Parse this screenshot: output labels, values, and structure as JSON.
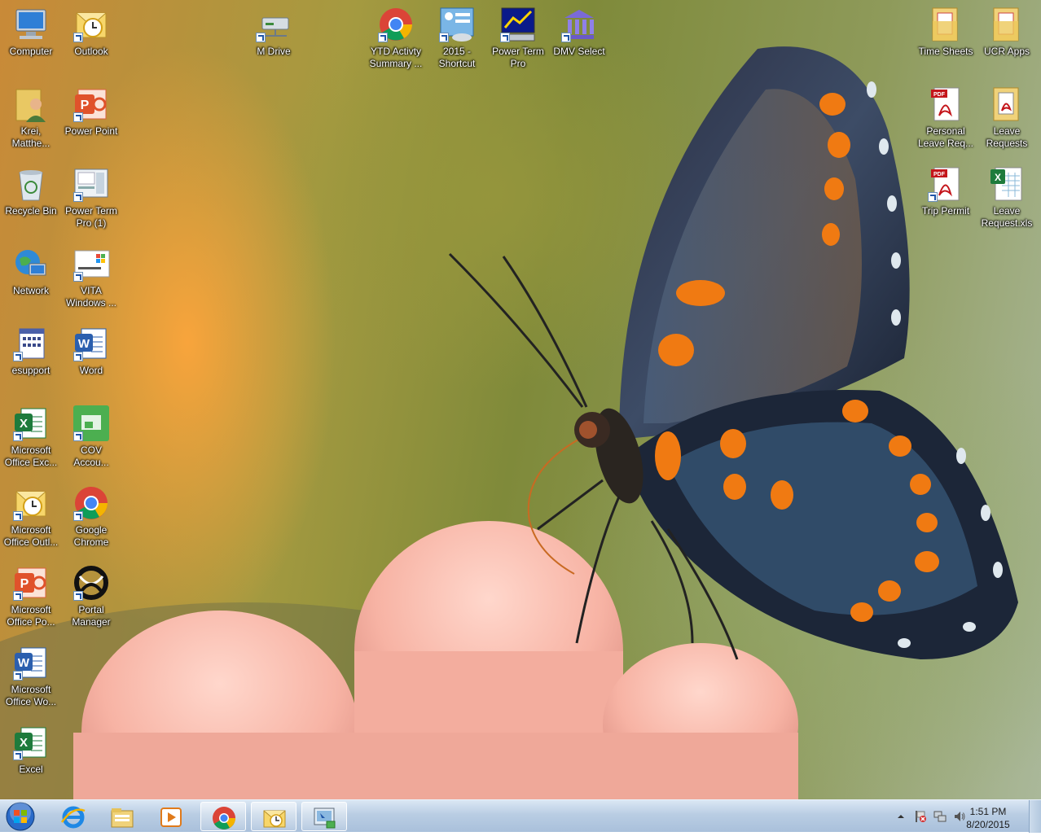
{
  "desktop": {
    "icons_left": [
      {
        "label": "Computer",
        "icon": "computer-icon"
      },
      {
        "label": "Outlook",
        "icon": "outlook-icon"
      },
      {
        "label": "Krei, Matthe...",
        "icon": "user-folder-icon"
      },
      {
        "label": "Power Point",
        "icon": "powerpoint-icon"
      },
      {
        "label": "Recycle Bin",
        "icon": "recycle-bin-icon"
      },
      {
        "label": "Power Term Pro (1)",
        "icon": "power-term-icon"
      },
      {
        "label": "Network",
        "icon": "network-icon"
      },
      {
        "label": "VITA Windows ...",
        "icon": "windows7-icon"
      },
      {
        "label": "esupport",
        "icon": "esupport-icon"
      },
      {
        "label": "Word",
        "icon": "word-icon"
      },
      {
        "label": "Microsoft Office Exc...",
        "icon": "excel-icon"
      },
      {
        "label": "COV Accou...",
        "icon": "cov-account-icon"
      },
      {
        "label": "Microsoft Office Outl...",
        "icon": "outlook-icon"
      },
      {
        "label": "Google Chrome",
        "icon": "chrome-icon"
      },
      {
        "label": "Microsoft Office Po...",
        "icon": "powerpoint-icon"
      },
      {
        "label": "Portal Manager",
        "icon": "portal-manager-icon"
      },
      {
        "label": "Microsoft Office Wo...",
        "icon": "word-icon"
      },
      {
        "label": "Excel",
        "icon": "excel-icon"
      }
    ],
    "icons_top": [
      {
        "label": "M Drive",
        "icon": "network-drive-icon"
      },
      {
        "label": "YTD Activty Summary ...",
        "icon": "chrome-icon"
      },
      {
        "label": "2015 - Shortcut",
        "icon": "shortcut-2015-icon"
      },
      {
        "label": "Power Term Pro",
        "icon": "power-term-icon"
      },
      {
        "label": "DMV Select",
        "icon": "dmv-select-icon"
      }
    ],
    "icons_right": [
      {
        "label": "Time Sheets",
        "icon": "folder-icon"
      },
      {
        "label": "UCR Apps",
        "icon": "folder-icon"
      },
      {
        "label": "Personal Leave Req...",
        "icon": "pdf-icon"
      },
      {
        "label": "Leave Requests",
        "icon": "pdf-folder-icon"
      },
      {
        "label": "Trip Permit",
        "icon": "pdf-icon"
      },
      {
        "label": "Leave Request.xls",
        "icon": "excel-file-icon"
      }
    ]
  },
  "taskbar": {
    "pinned": [
      {
        "name": "internet-explorer",
        "icon": "ie-icon"
      },
      {
        "name": "windows-explorer",
        "icon": "explorer-icon"
      },
      {
        "name": "media-player",
        "icon": "media-player-icon"
      },
      {
        "name": "chrome",
        "icon": "chrome-icon"
      },
      {
        "name": "outlook",
        "icon": "outlook-icon"
      },
      {
        "name": "remote-app",
        "icon": "remote-app-icon"
      }
    ],
    "time": "1:51 PM",
    "date": "8/20/2015"
  },
  "colors": {
    "taskbar": "#b9cde3",
    "label_text": "#ffffff",
    "excel_green": "#1e7b3c",
    "word_blue": "#2b5fae",
    "pdf_red": "#c4161c",
    "office_orange": "#e0522b"
  }
}
